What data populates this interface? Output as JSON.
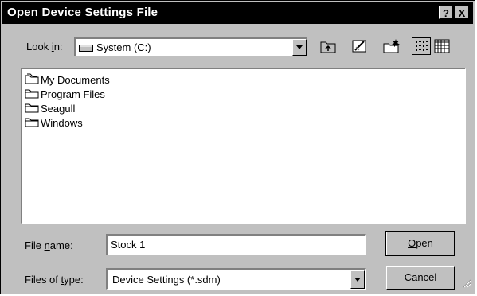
{
  "window": {
    "title": "Open Device Settings File",
    "help_label": "?",
    "close_label": "X"
  },
  "look_in": {
    "label_prefix": "Look ",
    "label_key": "i",
    "label_suffix": "n:",
    "value": "System (C:)",
    "icon": "hard-drive-icon"
  },
  "toolbar": {
    "tools": [
      {
        "name": "up-one-level-icon"
      },
      {
        "name": "desktop-icon"
      },
      {
        "name": "new-folder-icon"
      },
      {
        "name": "list-view-icon"
      },
      {
        "name": "details-view-icon"
      }
    ]
  },
  "files": [
    {
      "label": "My Documents",
      "icon": "my-documents-folder-icon"
    },
    {
      "label": "Program Files",
      "icon": "folder-icon"
    },
    {
      "label": "Seagull",
      "icon": "folder-icon"
    },
    {
      "label": "Windows",
      "icon": "folder-icon"
    }
  ],
  "file_name": {
    "label_prefix": "File ",
    "label_key": "n",
    "label_suffix": "ame:",
    "value": "Stock 1"
  },
  "file_type": {
    "label_prefix": "Files of ",
    "label_key": "t",
    "label_suffix": "ype:",
    "value": "Device Settings (*.sdm)"
  },
  "buttons": {
    "open_key": "O",
    "open_rest": "pen",
    "cancel": "Cancel"
  },
  "colors": {
    "face": "#c0c0c0",
    "titlebar": "#000000",
    "window": "#ffffff"
  }
}
